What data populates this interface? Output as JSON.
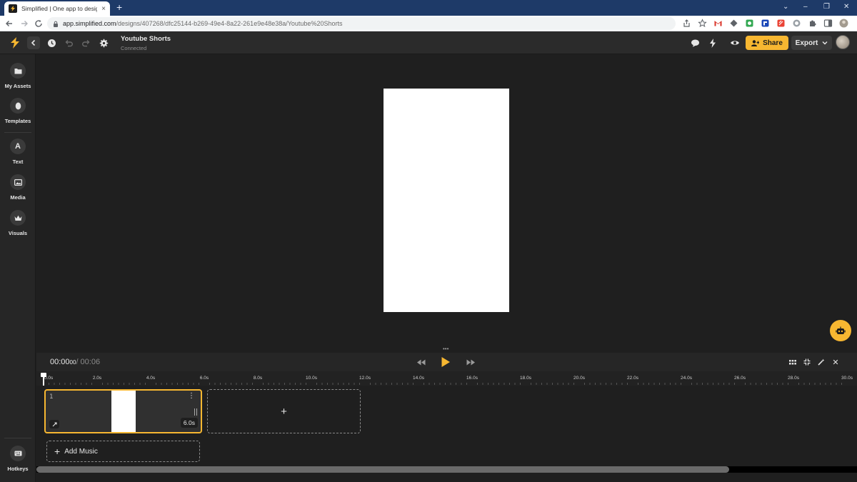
{
  "browser": {
    "tab_title": "Simplified | One app to design, c",
    "tab_close": "×",
    "new_tab": "+",
    "url_host": "app.simplified.com",
    "url_path": "/designs/407268/dfc25144-b269-49e4-8a22-261e9e48e38a/Youtube%20Shorts",
    "window_controls": [
      "⌄",
      "–",
      "❐",
      "✕"
    ]
  },
  "toolbar": {
    "doc_title": "Youtube Shorts",
    "doc_status": "Connected",
    "share_label": "Share",
    "export_label": "Export"
  },
  "sidebar": {
    "items": [
      {
        "label": "My Assets",
        "icon": "folder-icon"
      },
      {
        "label": "Templates",
        "icon": "templates-icon"
      },
      {
        "label": "Text",
        "icon": "text-icon",
        "glyph": "A"
      },
      {
        "label": "Media",
        "icon": "image-icon"
      },
      {
        "label": "Visuals",
        "icon": "crown-icon"
      }
    ],
    "hotkeys_label": "Hotkeys"
  },
  "timeline": {
    "current_time": "00:00",
    "current_ms": "00",
    "total_time": "/ 00:06",
    "ticks": [
      "0.0s",
      "2.0s",
      "4.0s",
      "6.0s",
      "8.0s",
      "10.0s",
      "12.0s",
      "14.0s",
      "16.0s",
      "18.0s",
      "20.0s",
      "22.0s",
      "24.0s",
      "26.0s",
      "28.0s",
      "30.0s"
    ],
    "scene": {
      "number": "1",
      "duration": "6.0s",
      "more": "⋮"
    },
    "add_scene": "+",
    "add_music_plus": "+",
    "add_music_label": "Add Music",
    "close": "✕"
  },
  "colors": {
    "accent": "#f7b731",
    "app_bg": "#1f1f1f",
    "panel_bg": "#262626",
    "chrome_tabbar": "#1e3a68"
  }
}
